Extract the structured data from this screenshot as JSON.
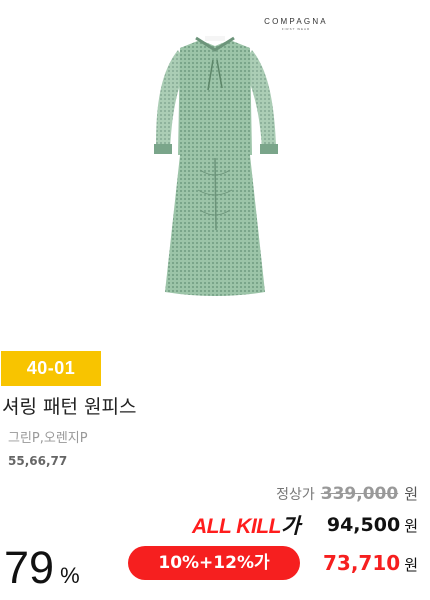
{
  "product": {
    "brand": "COMPAGNA",
    "brand_sub": "FIRST WEAR",
    "code": "40-01",
    "name": "셔링 패턴 원피스",
    "colors": "그린P,오렌지P",
    "sizes": "55,66,77",
    "image_icon": "green-check-dress-photo"
  },
  "pricing": {
    "regular_label": "정상가",
    "regular_price": "339,000",
    "currency": "원",
    "allkill_logo_red": "ALL KILL",
    "allkill_logo_black": "가",
    "allkill_price": "94,500",
    "discount_rate": "79",
    "percent_sign": "%",
    "coupon_label": "10%+12%가",
    "final_price": "73,710"
  },
  "colors": {
    "badge_yellow": "#f8c400",
    "accent_red": "#f61f1f",
    "dress_green": "#8fb79b"
  }
}
